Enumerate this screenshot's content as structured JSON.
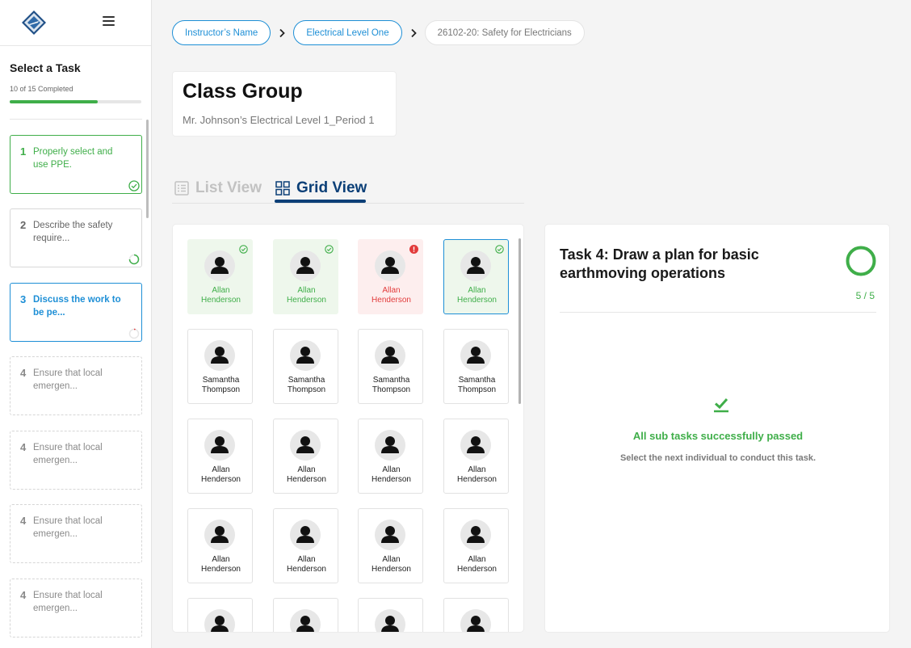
{
  "sidebar": {
    "title": "Select a Task",
    "progress_text": "10 of 15 Completed",
    "progress_fraction": 0.667,
    "tasks": [
      {
        "num": "1",
        "label": "Properly select and use PPE.",
        "status": "done"
      },
      {
        "num": "2",
        "label": "Describe the safety require...",
        "status": "in-progress"
      },
      {
        "num": "3",
        "label": "Discuss the work to be pe...",
        "status": "active"
      },
      {
        "num": "4",
        "label": "Ensure that local emergen...",
        "status": "todo"
      },
      {
        "num": "4",
        "label": "Ensure that local emergen...",
        "status": "todo"
      },
      {
        "num": "4",
        "label": "Ensure that local emergen...",
        "status": "todo"
      },
      {
        "num": "4",
        "label": "Ensure that local emergen...",
        "status": "todo"
      }
    ]
  },
  "breadcrumb": {
    "items": [
      "Instructor’s Name",
      "Electrical Level One",
      "26102-20: Safety for Electricians"
    ]
  },
  "class_group": {
    "title": "Class Group",
    "subtitle": "Mr. Johnson’s Electrical Level 1_Period 1"
  },
  "views": {
    "list_label": "List View",
    "grid_label": "Grid View",
    "selected": "grid"
  },
  "students": [
    {
      "first": "Allan",
      "last": "Henderson",
      "status": "pass"
    },
    {
      "first": "Allan",
      "last": "Henderson",
      "status": "pass"
    },
    {
      "first": "Allan",
      "last": "Henderson",
      "status": "fail"
    },
    {
      "first": "Allan",
      "last": "Henderson",
      "status": "selected"
    },
    {
      "first": "Samantha",
      "last": "Thompson",
      "status": "none"
    },
    {
      "first": "Samantha",
      "last": "Thompson",
      "status": "none"
    },
    {
      "first": "Samantha",
      "last": "Thompson",
      "status": "none"
    },
    {
      "first": "Samantha",
      "last": "Thompson",
      "status": "none"
    },
    {
      "first": "Allan",
      "last": "Henderson",
      "status": "none"
    },
    {
      "first": "Allan",
      "last": "Henderson",
      "status": "none"
    },
    {
      "first": "Allan",
      "last": "Henderson",
      "status": "none"
    },
    {
      "first": "Allan",
      "last": "Henderson",
      "status": "none"
    },
    {
      "first": "Allan",
      "last": "Henderson",
      "status": "none"
    },
    {
      "first": "Allan",
      "last": "Henderson",
      "status": "none"
    },
    {
      "first": "Allan",
      "last": "Henderson",
      "status": "none"
    },
    {
      "first": "Allan",
      "last": "Henderson",
      "status": "none"
    },
    {
      "first": "",
      "last": "",
      "status": "none"
    },
    {
      "first": "",
      "last": "",
      "status": "none"
    },
    {
      "first": "",
      "last": "",
      "status": "none"
    },
    {
      "first": "",
      "last": "",
      "status": "none"
    }
  ],
  "detail": {
    "title": "Task 4: Draw a plan for basic earthmoving operations",
    "count": "5 / 5",
    "pass_message": "All sub tasks successfully passed",
    "next_message": "Select the next individual to conduct this task."
  },
  "colors": {
    "success": "#3fae49",
    "error": "#e23b3b",
    "link": "#1e8fd6",
    "navy": "#0b3f77"
  }
}
